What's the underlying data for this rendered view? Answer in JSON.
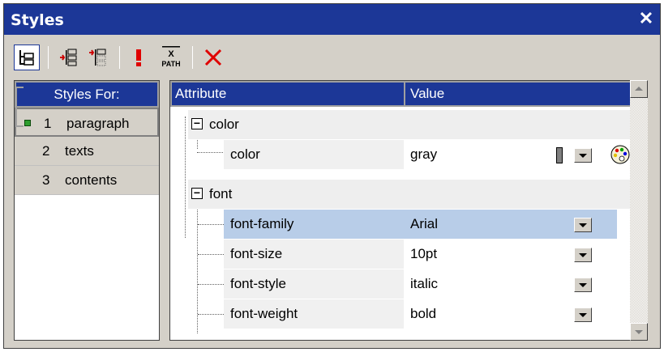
{
  "window": {
    "title": "Styles"
  },
  "toolbar": {
    "buttons": [
      {
        "icon": "tree-view-icon"
      },
      {
        "icon": "add-style-icon"
      },
      {
        "icon": "append-style-icon"
      },
      {
        "icon": "important-icon"
      },
      {
        "icon": "xpath-icon",
        "label_top": "X",
        "label_bottom": "PATH"
      },
      {
        "icon": "delete-icon"
      }
    ]
  },
  "styles_for": {
    "header": "Styles For:",
    "items": [
      {
        "num": "1",
        "label": "paragraph",
        "selected": true
      },
      {
        "num": "2",
        "label": "texts"
      },
      {
        "num": "3",
        "label": "contents"
      }
    ]
  },
  "grid": {
    "headers": {
      "attribute": "Attribute",
      "value": "Value"
    },
    "groups": [
      {
        "name": "color",
        "items": [
          {
            "attribute": "color",
            "value": "gray",
            "swatch": "#808080",
            "has_palette": true
          }
        ]
      },
      {
        "name": "font",
        "items": [
          {
            "attribute": "font-family",
            "value": "Arial",
            "selected": true
          },
          {
            "attribute": "font-size",
            "value": "10pt"
          },
          {
            "attribute": "font-style",
            "value": "italic"
          },
          {
            "attribute": "font-weight",
            "value": "bold"
          }
        ]
      }
    ]
  },
  "colors": {
    "titlebar": "#1c3797",
    "selection": "#b8cde8",
    "chrome": "#d4d0c8"
  }
}
